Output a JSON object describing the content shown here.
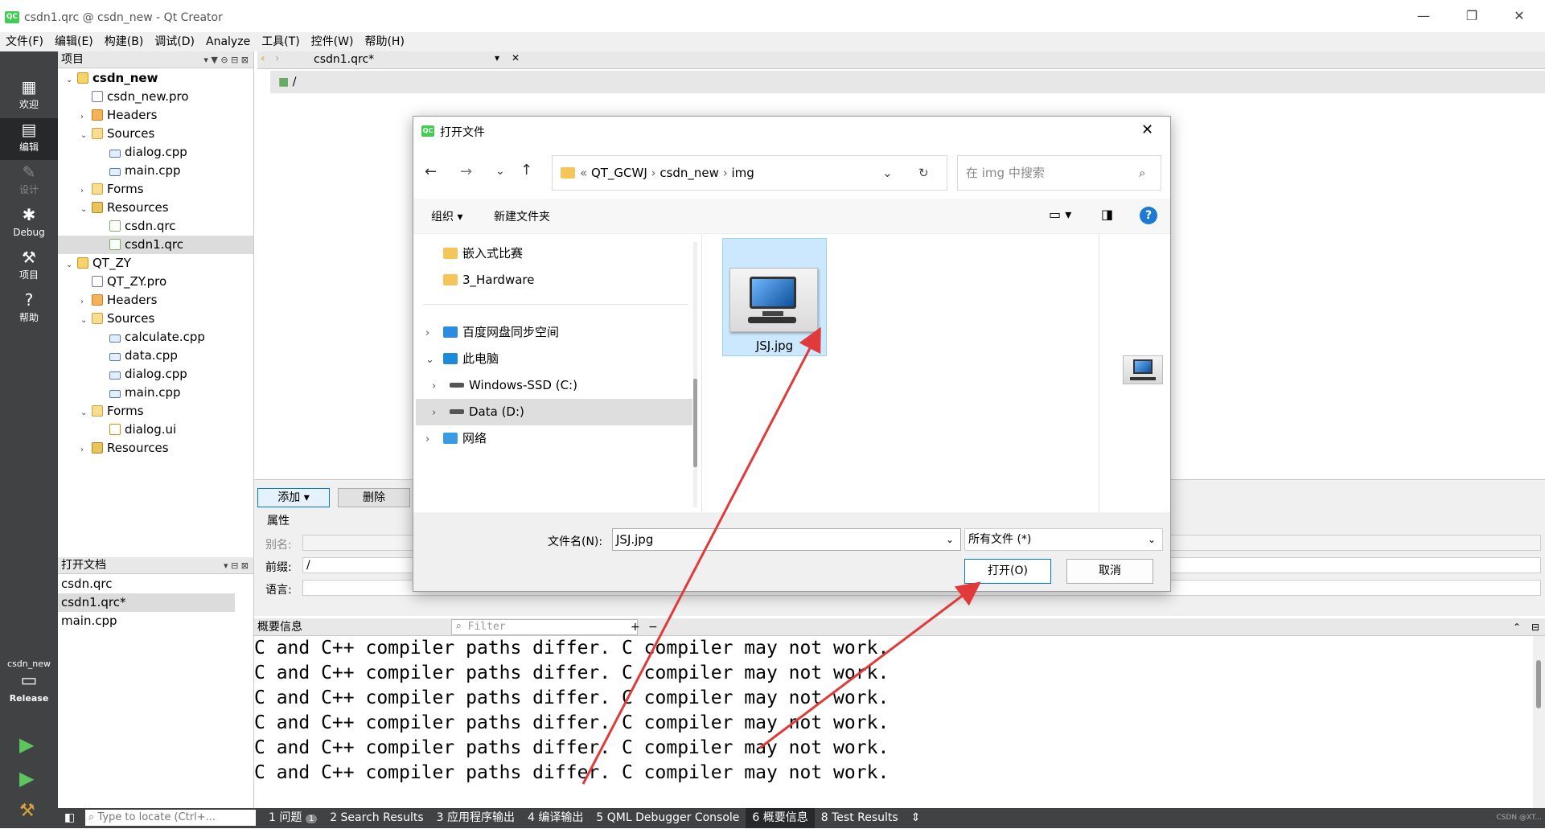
{
  "window": {
    "title": "csdn1.qrc @ csdn_new - Qt Creator",
    "logo": "QC",
    "controls": [
      "—",
      "❐",
      "✕"
    ]
  },
  "menubar": [
    "文件(F)",
    "编辑(E)",
    "构建(B)",
    "调试(D)",
    "Analyze",
    "工具(T)",
    "控件(W)",
    "帮助(H)"
  ],
  "modes": [
    {
      "label": "欢迎",
      "icon": "grid-icon"
    },
    {
      "label": "编辑",
      "icon": "edit-icon"
    },
    {
      "label": "设计",
      "icon": "pencil-icon"
    },
    {
      "label": "Debug",
      "icon": "bug-icon"
    },
    {
      "label": "项目",
      "icon": "wrench-icon"
    },
    {
      "label": "帮助",
      "icon": "help-icon"
    }
  ],
  "kit": {
    "project": "csdn_new",
    "build": "Release"
  },
  "project_pane": {
    "title": "项目",
    "tree": [
      {
        "label": "csdn_new",
        "level": 0,
        "arrow": "⌄",
        "icon": "ic-proj",
        "bold": true
      },
      {
        "label": "csdn_new.pro",
        "level": 1,
        "arrow": "",
        "icon": "ic-pro"
      },
      {
        "label": "Headers",
        "level": 1,
        "arrow": "›",
        "icon": "ic-hdr"
      },
      {
        "label": "Sources",
        "level": 1,
        "arrow": "⌄",
        "icon": "ic-src"
      },
      {
        "label": "dialog.cpp",
        "level": 2,
        "arrow": "",
        "icon": "ic-cpp"
      },
      {
        "label": "main.cpp",
        "level": 2,
        "arrow": "",
        "icon": "ic-cpp"
      },
      {
        "label": "Forms",
        "level": 1,
        "arrow": "›",
        "icon": "ic-src"
      },
      {
        "label": "Resources",
        "level": 1,
        "arrow": "⌄",
        "icon": "ic-res"
      },
      {
        "label": "csdn.qrc",
        "level": 2,
        "arrow": "",
        "icon": "ic-qrc"
      },
      {
        "label": "csdn1.qrc",
        "level": 2,
        "arrow": "",
        "icon": "ic-qrc",
        "selected": true
      },
      {
        "label": "QT_ZY",
        "level": 0,
        "arrow": "⌄",
        "icon": "ic-proj"
      },
      {
        "label": "QT_ZY.pro",
        "level": 1,
        "arrow": "",
        "icon": "ic-pro"
      },
      {
        "label": "Headers",
        "level": 1,
        "arrow": "›",
        "icon": "ic-hdr"
      },
      {
        "label": "Sources",
        "level": 1,
        "arrow": "⌄",
        "icon": "ic-src"
      },
      {
        "label": "calculate.cpp",
        "level": 2,
        "arrow": "",
        "icon": "ic-cpp"
      },
      {
        "label": "data.cpp",
        "level": 2,
        "arrow": "",
        "icon": "ic-cpp"
      },
      {
        "label": "dialog.cpp",
        "level": 2,
        "arrow": "",
        "icon": "ic-cpp"
      },
      {
        "label": "main.cpp",
        "level": 2,
        "arrow": "",
        "icon": "ic-cpp"
      },
      {
        "label": "Forms",
        "level": 1,
        "arrow": "⌄",
        "icon": "ic-src"
      },
      {
        "label": "dialog.ui",
        "level": 2,
        "arrow": "",
        "icon": "ic-ui"
      },
      {
        "label": "Resources",
        "level": 1,
        "arrow": "›",
        "icon": "ic-res"
      }
    ]
  },
  "open_docs": {
    "title": "打开文档",
    "items": [
      {
        "label": "csdn.qrc"
      },
      {
        "label": "csdn1.qrc*",
        "selected": true
      },
      {
        "label": "main.cpp"
      }
    ]
  },
  "editor": {
    "file_tab": "csdn1.qrc*",
    "prefix_path": "/",
    "add_button": "添加",
    "delete_button": "删除",
    "props_title": "属性",
    "alias_label": "别名:",
    "prefix_label": "前缀:",
    "prefix_value": "/",
    "lang_label": "语言:"
  },
  "output": {
    "title": "概要信息",
    "filter_placeholder": "Filter",
    "lines": [
      "C and C++ compiler paths differ. C compiler may not work.",
      "C and C++ compiler paths differ. C compiler may not work.",
      "C and C++ compiler paths differ. C compiler may not work.",
      "C and C++ compiler paths differ. C compiler may not work.",
      "C and C++ compiler paths differ. C compiler may not work.",
      "C and C++ compiler paths differ. C compiler may not work."
    ]
  },
  "statusbar": {
    "locate_placeholder": "Type to locate (Ctrl+...",
    "items": [
      "1 问题",
      "2 Search Results",
      "3 应用程序输出",
      "4 编译输出",
      "5 QML Debugger Console",
      "6 概要信息",
      "8 Test Results"
    ],
    "issues_badge": "1",
    "active_index": 5,
    "watermark": "CSDN @XT..."
  },
  "dialog": {
    "title": "打开文件",
    "logo": "QC",
    "breadcrumb": [
      "QT_GCWJ",
      "csdn_new",
      "img"
    ],
    "search_placeholder": "在 img 中搜索",
    "organize_label": "组织",
    "new_folder_label": "新建文件夹",
    "nav_items": [
      {
        "label": "嵌入式比赛",
        "type": "folder"
      },
      {
        "label": "3_Hardware",
        "type": "folder"
      },
      {
        "label": "百度网盘同步空间",
        "type": "cloud",
        "arrow": "›"
      },
      {
        "label": "此电脑",
        "type": "pc",
        "arrow": "⌄"
      },
      {
        "label": "Windows-SSD (C:)",
        "type": "drive",
        "arrow": "›"
      },
      {
        "label": "Data (D:)",
        "type": "drive",
        "arrow": "›",
        "selected": true
      },
      {
        "label": "网络",
        "type": "network",
        "arrow": "›"
      }
    ],
    "file": {
      "name": "JSJ.jpg"
    },
    "filename_label": "文件名(N):",
    "filename_value": "JSJ.jpg",
    "filetype_value": "所有文件 (*)",
    "open_button": "打开(O)",
    "cancel_button": "取消"
  },
  "accent_color": "#e03a3a"
}
